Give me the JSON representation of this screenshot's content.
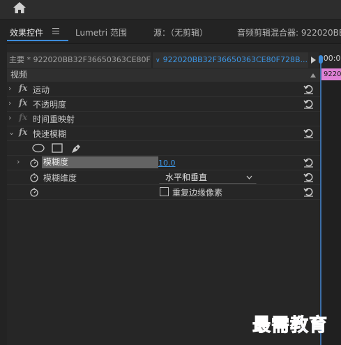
{
  "tabs": [
    {
      "label": "效果控件"
    },
    {
      "label": "Lumetri 范围"
    },
    {
      "label": "源：（无剪辑）"
    },
    {
      "label": "音频剪辑混合器: 922020BB"
    }
  ],
  "source": {
    "master_label": "主要 * 922020BB32F36650363CE80F7...",
    "clip_label": "922020BB32F36650363CE80F728B...",
    "timecode": ":00:00"
  },
  "section": {
    "label": "视频"
  },
  "clip_bar_label": "922020",
  "effects": [
    {
      "label": "运动"
    },
    {
      "label": "不透明度"
    },
    {
      "label": "时间重映射"
    },
    {
      "label": "快速模糊"
    }
  ],
  "blur": {
    "amount_label": "模糊度",
    "amount_value": "10.0",
    "dimension_label": "模糊维度",
    "dimension_value": "水平和垂直",
    "repeat_edge_label": "重复边缘像素"
  },
  "icons": {
    "home": "home-icon",
    "fx": "fx",
    "reset": "reset-icon",
    "stopwatch": "stopwatch-icon",
    "mask_ellipse": "ellipse-mask-icon",
    "mask_rect": "rectangle-mask-icon",
    "mask_pen": "pen-mask-icon"
  },
  "colors": {
    "accent": "#3d97e6",
    "clip": "#e081d6",
    "watermark": "#2b4fd6"
  },
  "watermark": "最需教育"
}
